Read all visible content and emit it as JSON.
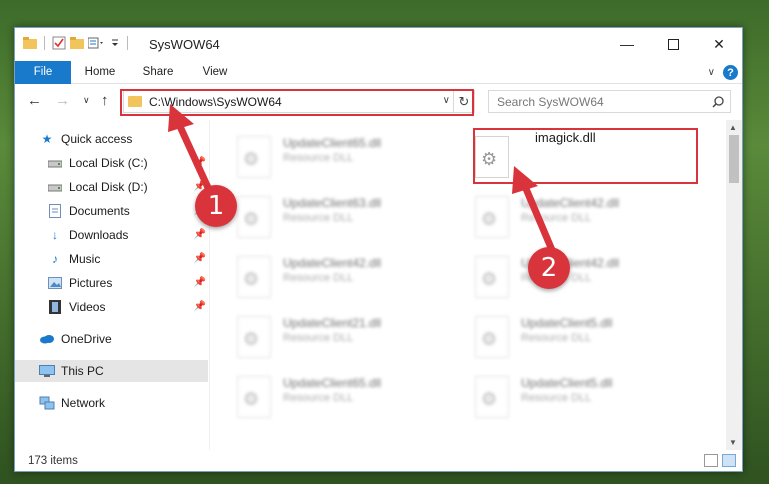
{
  "window": {
    "title": "SysWOW64"
  },
  "ribbon": {
    "tabs": [
      "File",
      "Home",
      "Share",
      "View"
    ]
  },
  "address": {
    "path": "C:\\Windows\\SysWOW64",
    "search_placeholder": "Search SysWOW64"
  },
  "nav": {
    "items": [
      {
        "label": "Quick access",
        "icon": "star-icon",
        "pinned": false
      },
      {
        "label": "Local Disk (C:)",
        "icon": "drive-icon",
        "pinned": true
      },
      {
        "label": "Local Disk (D:)",
        "icon": "drive-icon",
        "pinned": true
      },
      {
        "label": "Documents",
        "icon": "document-icon",
        "pinned": true
      },
      {
        "label": "Downloads",
        "icon": "download-icon",
        "pinned": true
      },
      {
        "label": "Music",
        "icon": "music-icon",
        "pinned": true
      },
      {
        "label": "Pictures",
        "icon": "pictures-icon",
        "pinned": true
      },
      {
        "label": "Videos",
        "icon": "video-icon",
        "pinned": true
      },
      {
        "label": "OneDrive",
        "icon": "cloud-icon",
        "pinned": false
      },
      {
        "label": "This PC",
        "icon": "computer-icon",
        "pinned": false,
        "selected": true
      },
      {
        "label": "Network",
        "icon": "network-icon",
        "pinned": false
      }
    ]
  },
  "files": {
    "left": [
      {
        "name": "UpdateClient65.dll",
        "type": "Resource DLL"
      },
      {
        "name": "UpdateClient63.dll",
        "type": "Resource DLL"
      },
      {
        "name": "UpdateClient42.dll",
        "type": "Resource DLL"
      },
      {
        "name": "UpdateClient21.dll",
        "type": "Resource DLL"
      },
      {
        "name": "UpdateClient65.dll",
        "type": "Resource DLL"
      }
    ],
    "right": [
      {
        "name": "imagick.dll",
        "type": "",
        "highlighted": true
      },
      {
        "name": "UpdateClient42.dll",
        "type": "Resource DLL"
      },
      {
        "name": "UpdateClient42.dll",
        "type": "Resource DLL"
      },
      {
        "name": "UpdateClient5.dll",
        "type": "Resource DLL"
      },
      {
        "name": "UpdateClient5.dll",
        "type": "Resource DLL"
      }
    ]
  },
  "status": {
    "item_count": "173 items"
  },
  "annotations": {
    "step1": "1",
    "step2": "2",
    "highlight_color": "#d9333b"
  }
}
